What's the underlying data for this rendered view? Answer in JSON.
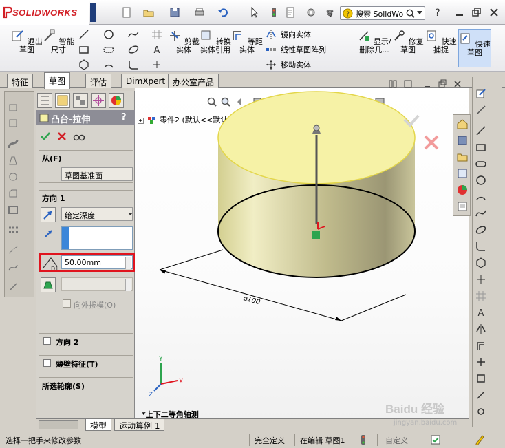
{
  "app": {
    "brand": "SOLIDWORKS",
    "search_placeholder": "搜索 SolidWo",
    "quick_buttons": [
      "new-document",
      "open",
      "save",
      "print",
      "undo",
      "select",
      "rebuild",
      "options",
      "help",
      "minimize",
      "restore",
      "close"
    ]
  },
  "ribbon": {
    "exit_sketch": "退出草图",
    "smart_dimension": "智能尺寸",
    "trim_entities": "剪裁实体",
    "convert_entities": "转换实体引用",
    "offset_entities": "等距实体",
    "mirror_entities": "镜向实体",
    "linear_pattern": "线性草图阵列",
    "move_entities": "移动实体",
    "display_delete": "显示/删除几...",
    "repair_sketch": "修复草图",
    "quick_snaps": "快速捕捉",
    "rapid_sketch": "快速草图"
  },
  "tabs": [
    {
      "label": "特征",
      "active": false
    },
    {
      "label": "草图",
      "active": true
    },
    {
      "label": "评估",
      "active": false
    },
    {
      "label": "DimXpert",
      "active": false
    },
    {
      "label": "办公室产品",
      "active": false
    }
  ],
  "pm": {
    "title": "凸台-拉伸",
    "help": "?",
    "from": {
      "header": "从(F)",
      "value": "草图基准面"
    },
    "direction1": {
      "header": "方向 1",
      "end_condition": "给定深度",
      "depth": "50.00mm",
      "draft_outward": "向外拔模(O)"
    },
    "direction2": "方向 2",
    "thin_feature": "薄壁特征(T)",
    "selected_contours": "所选轮廓(S)"
  },
  "graphics": {
    "tree_text": "零件2  (默认<<默认>_显...",
    "dimension_text": "⌀100",
    "view_label": "*上下二等角轴测",
    "triad": {
      "x": "X",
      "y": "Y",
      "z": "Z"
    }
  },
  "bottom_tabs": [
    {
      "label": "模型",
      "active": true
    },
    {
      "label": "运动算例 1",
      "active": false
    }
  ],
  "status": {
    "hint": "选择一把手来修改参数",
    "definition": "完全定义",
    "editing": "在编辑 草图1",
    "custom": "自定义"
  },
  "watermark": "Baidu 经验",
  "watermark_url": "jingyan.baidu.com",
  "colors": {
    "accent": "#d21f26",
    "cylinder_top": "#f6f2a6",
    "highlight_box": "#e0141e",
    "selection_blue": "#3b86d9"
  }
}
